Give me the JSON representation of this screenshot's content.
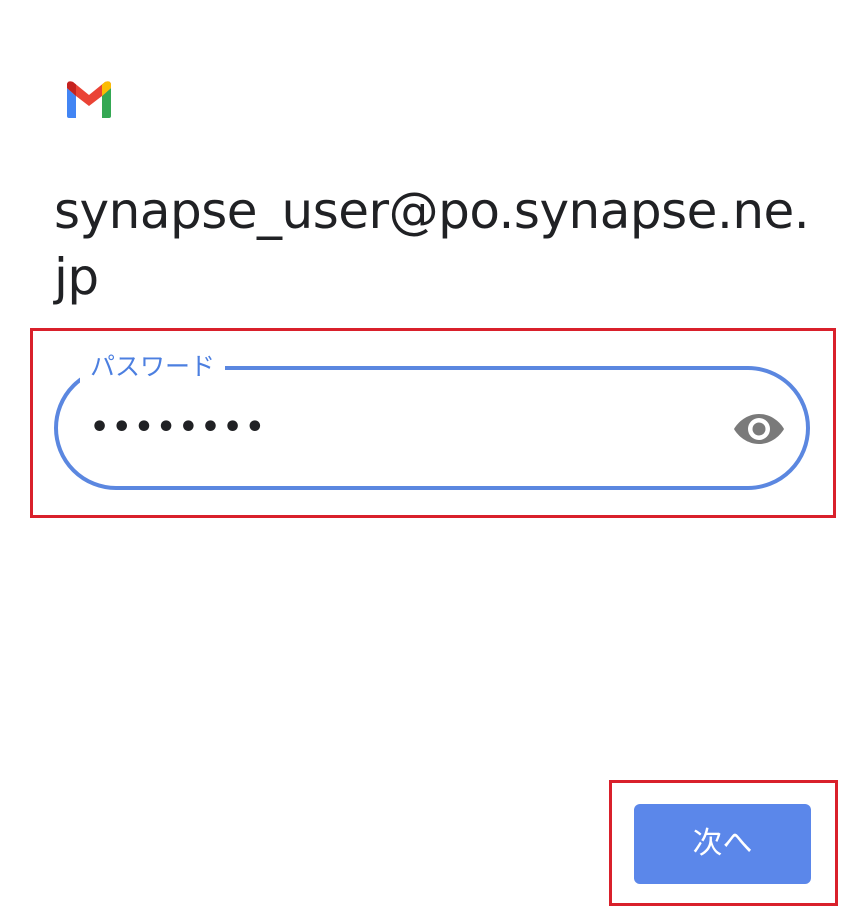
{
  "account": {
    "email": "synapse_user@po.synapse.ne.jp"
  },
  "password_field": {
    "label": "パスワード",
    "value": "••••••••"
  },
  "actions": {
    "next_label": "次へ"
  },
  "colors": {
    "accent": "#5b87e0",
    "button": "#5b87ea",
    "highlight": "#d9202b",
    "icon_gray": "#7a7a7a",
    "text": "#202124"
  },
  "icons": {
    "logo": "gmail-logo",
    "visibility": "eye-icon"
  }
}
